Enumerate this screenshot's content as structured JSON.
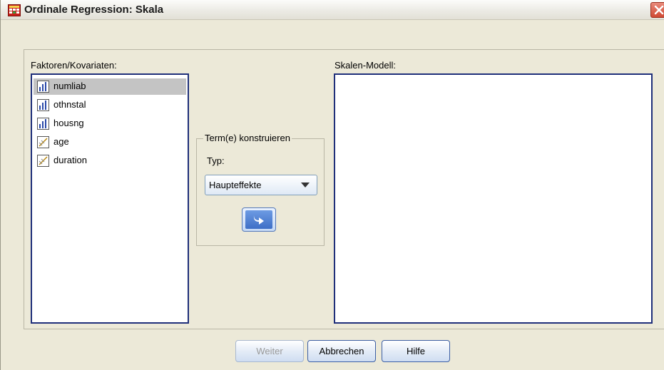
{
  "window": {
    "title": "Ordinale Regression: Skala",
    "title_icon": "spss-dialog-icon",
    "close_icon": "close-icon"
  },
  "factors": {
    "label": "Faktoren/Kovariaten:",
    "items": [
      {
        "label": "numliab",
        "icon": "ordinal-variable-icon",
        "selected": true
      },
      {
        "label": "othnstal",
        "icon": "ordinal-variable-icon",
        "selected": false
      },
      {
        "label": "housng",
        "icon": "ordinal-variable-icon",
        "selected": false
      },
      {
        "label": "age",
        "icon": "scale-variable-icon",
        "selected": false
      },
      {
        "label": "duration",
        "icon": "scale-variable-icon",
        "selected": false
      }
    ]
  },
  "build_term": {
    "group_label": "Term(e) konstruieren",
    "type_label": "Typ:",
    "type_value": "Haupteffekte",
    "move_icon": "move-right-arrow-icon"
  },
  "scale_model": {
    "label": "Skalen-Modell:"
  },
  "buttons": {
    "continue": "Weiter",
    "cancel": "Abbrechen",
    "help": "Hilfe"
  },
  "colors": {
    "dialog_bg": "#ece9d8",
    "listbox_border": "#1f2f7a",
    "selection": "#c4c4c4",
    "button_border": "#3c5fa5"
  }
}
